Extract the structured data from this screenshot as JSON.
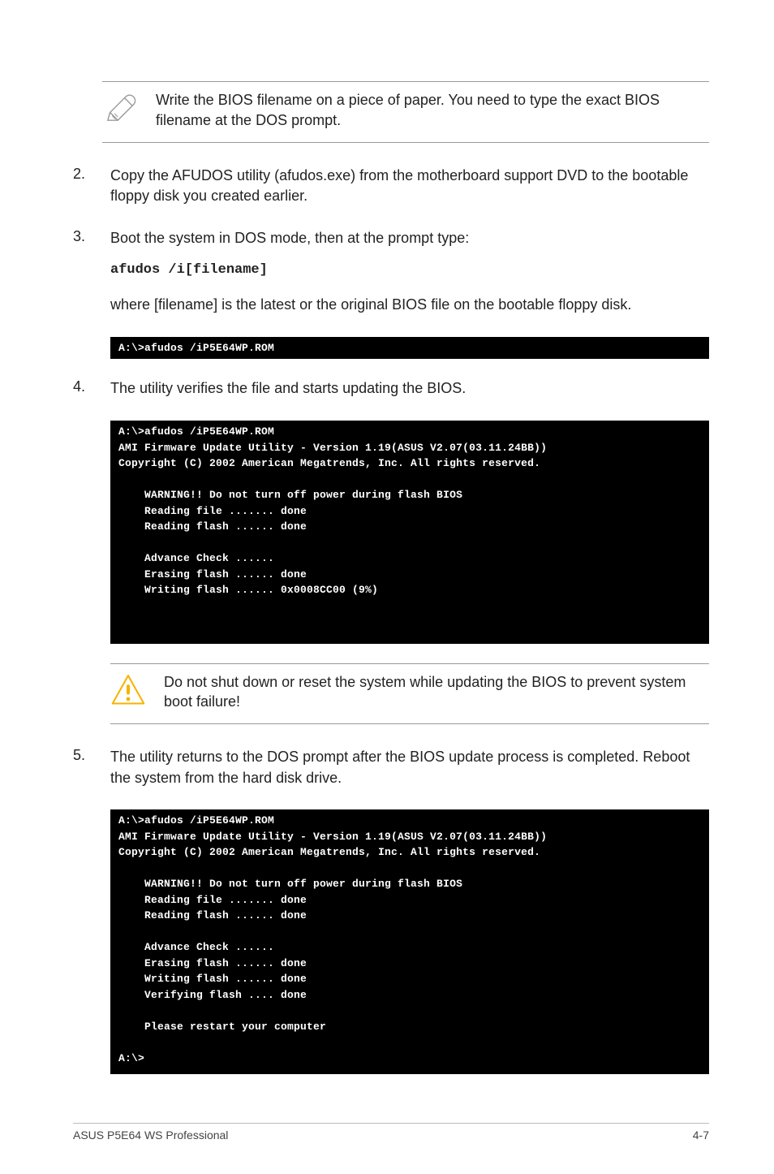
{
  "note1": {
    "text": "Write the BIOS filename on a piece of paper. You need to type the exact BIOS filename at the DOS prompt."
  },
  "steps": {
    "s2": {
      "num": "2.",
      "text": "Copy the AFUDOS utility (afudos.exe) from the motherboard support DVD to the bootable floppy disk you created earlier."
    },
    "s3": {
      "num": "3.",
      "line1": "Boot the system in DOS mode, then at the prompt type:",
      "code": "afudos /i[filename]",
      "line2": "where [filename] is the latest or the original BIOS file on the bootable floppy disk."
    },
    "s4": {
      "num": "4.",
      "text": "The utility verifies the file and starts updating the BIOS."
    },
    "s5": {
      "num": "5.",
      "text": "The utility returns to the DOS prompt after the BIOS update process is completed. Reboot the system from the hard disk drive."
    }
  },
  "terminals": {
    "t1": "A:\\>afudos /iP5E64WP.ROM",
    "t2": "A:\\>afudos /iP5E64WP.ROM\nAMI Firmware Update Utility - Version 1.19(ASUS V2.07(03.11.24BB))\nCopyright (C) 2002 American Megatrends, Inc. All rights reserved.\n\n    WARNING!! Do not turn off power during flash BIOS\n    Reading file ....... done\n    Reading flash ...... done\n\n    Advance Check ......\n    Erasing flash ...... done\n    Writing flash ...... 0x0008CC00 (9%)",
    "t3": "A:\\>afudos /iP5E64WP.ROM\nAMI Firmware Update Utility - Version 1.19(ASUS V2.07(03.11.24BB))\nCopyright (C) 2002 American Megatrends, Inc. All rights reserved.\n\n    WARNING!! Do not turn off power during flash BIOS\n    Reading file ....... done\n    Reading flash ...... done\n\n    Advance Check ......\n    Erasing flash ...... done\n    Writing flash ...... done\n    Verifying flash .... done\n\n    Please restart your computer\n\nA:\\>"
  },
  "warning": {
    "text": "Do not shut down or reset the system while updating the BIOS to prevent system boot failure!"
  },
  "footer": {
    "left": "ASUS P5E64 WS Professional",
    "right": "4-7"
  }
}
